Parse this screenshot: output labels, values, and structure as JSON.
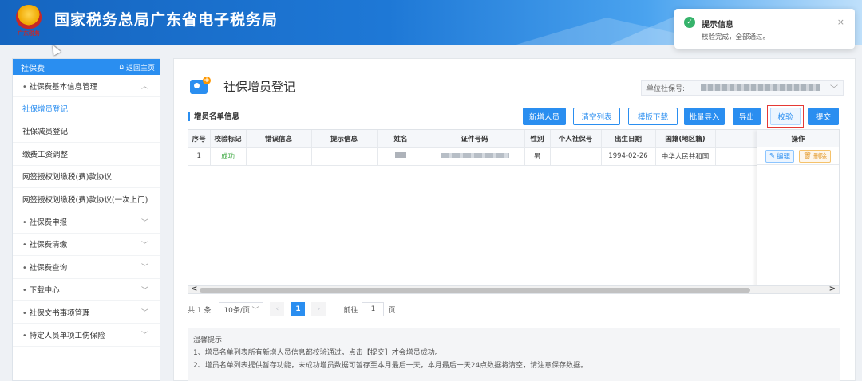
{
  "header": {
    "title": "国家税务总局广东省电子税务局",
    "logo_caption": "广东税务"
  },
  "sidebar": {
    "head_title": "社保费",
    "home_link": "返回主页",
    "items": [
      {
        "label": "社保费基本信息管理",
        "type": "parent",
        "chevron": "︿"
      },
      {
        "label": "社保增员登记",
        "type": "child",
        "active": true
      },
      {
        "label": "社保减员登记",
        "type": "child"
      },
      {
        "label": "缴费工资调整",
        "type": "child"
      },
      {
        "label": "网签授权划缴税(费)款协议",
        "type": "child"
      },
      {
        "label": "网签授权划缴税(费)款协议(一次上门)",
        "type": "child"
      },
      {
        "label": "社保费申报",
        "type": "parent",
        "chevron": "﹀"
      },
      {
        "label": "社保费清缴",
        "type": "parent",
        "chevron": "﹀"
      },
      {
        "label": "社保费查询",
        "type": "parent",
        "chevron": "﹀"
      },
      {
        "label": "下载中心",
        "type": "parent",
        "chevron": "﹀"
      },
      {
        "label": "社保文书事项管理",
        "type": "parent",
        "chevron": "﹀"
      },
      {
        "label": "特定人员单项工伤保险",
        "type": "parent",
        "chevron": "﹀"
      }
    ]
  },
  "main": {
    "page_title": "社保增员登记",
    "unit_label": "单位社保号:",
    "section_title": "增员名单信息",
    "toolbar": {
      "add": "新增人员",
      "clear": "清空列表",
      "template": "模板下载",
      "import": "批量导入",
      "export": "导出",
      "verify": "校验",
      "submit": "提交"
    },
    "table": {
      "headers": [
        "序号",
        "校验标记",
        "错误信息",
        "提示信息",
        "姓名",
        "证件号码",
        "性别",
        "个人社保号",
        "出生日期",
        "国籍(地区籍)"
      ],
      "op_header": "操作",
      "rows": [
        {
          "seq": "1",
          "check": "成功",
          "error": "",
          "hint": "",
          "name": "",
          "id": "",
          "gender": "男",
          "ssn": "",
          "birth": "1994-02-26",
          "nation": "中华人民共和国"
        }
      ],
      "edit_label": "编辑",
      "delete_label": "删除"
    },
    "pager": {
      "total": "共 1 条",
      "size": "10条/页",
      "current": "1",
      "goto_prefix": "前往",
      "goto_value": "1",
      "goto_suffix": "页"
    },
    "tips": {
      "title": "温馨提示:",
      "line1": "1、增员名单列表所有新增人员信息都校验通过，点击【提交】才会增员成功。",
      "line2": "2、增员名单列表提供暂存功能，未成功增员数据可暂存至本月最后一天，本月最后一天24点数据将清空，请注意保存数据。"
    }
  },
  "toast": {
    "title": "提示信息",
    "message": "校验完成，全部通过。",
    "close": "×"
  }
}
